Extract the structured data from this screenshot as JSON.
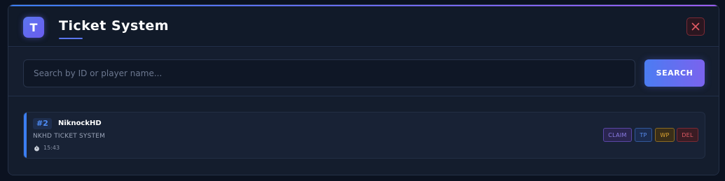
{
  "header": {
    "logo_letter": "T",
    "title": "Ticket System",
    "close_icon": "close-icon"
  },
  "search": {
    "placeholder": "Search by ID or player name...",
    "value": "",
    "button_label": "SEARCH"
  },
  "tickets": [
    {
      "id": "#2",
      "player": "NiknockHD",
      "subject": "NKHD TICKET SYSTEM",
      "time": "15:43",
      "time_icon": "clock-icon",
      "actions": [
        "CLAIM",
        "TP",
        "WP",
        "DEL"
      ]
    }
  ],
  "colors": {
    "accent": "#3b7ef2",
    "accent_purple": "#7a63ee",
    "claim": "#8b7ce6",
    "tp": "#5a8ef0",
    "wp": "#e0a632",
    "del": "#e05a64",
    "background": "#131b2b"
  }
}
